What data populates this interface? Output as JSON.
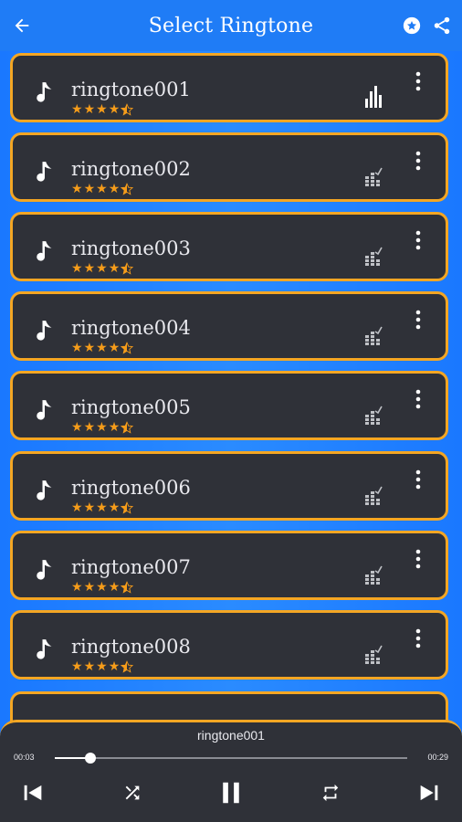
{
  "header": {
    "title": "Select Ringtone",
    "back_icon": "arrow-back-icon",
    "favorite_icon": "star-circle-icon",
    "share_icon": "share-icon"
  },
  "ringtones": [
    {
      "name": "ringtone001",
      "rating": 4.5,
      "playing": true
    },
    {
      "name": "ringtone002",
      "rating": 4.5,
      "playing": false
    },
    {
      "name": "ringtone003",
      "rating": 4.5,
      "playing": false
    },
    {
      "name": "ringtone004",
      "rating": 4.5,
      "playing": false
    },
    {
      "name": "ringtone005",
      "rating": 4.5,
      "playing": false
    },
    {
      "name": "ringtone006",
      "rating": 4.5,
      "playing": false
    },
    {
      "name": "ringtone007",
      "rating": 4.5,
      "playing": false
    },
    {
      "name": "ringtone008",
      "rating": 4.5,
      "playing": false
    }
  ],
  "player": {
    "now_playing": "ringtone001",
    "elapsed": "00:03",
    "duration": "00:29",
    "progress": 0.1
  },
  "colors": {
    "accent": "#f4a623",
    "card": "#2f3138",
    "background": "#1f7cf6",
    "star": "#f59c1a"
  }
}
